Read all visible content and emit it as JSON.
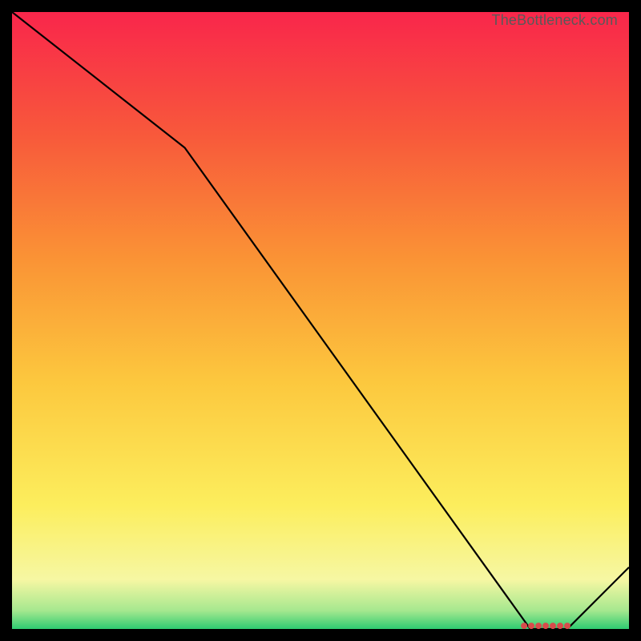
{
  "watermark": "TheBottleneck.com",
  "chart_data": {
    "type": "line",
    "x": [
      0,
      0.28,
      0.84,
      0.9,
      1.0
    ],
    "y": [
      1.0,
      0.78,
      0.0,
      0.0,
      0.1
    ],
    "title": "",
    "xlabel": "",
    "ylabel": "",
    "xlim": [
      0,
      1
    ],
    "ylim": [
      0,
      1
    ],
    "marker_region": {
      "x_start": 0.83,
      "x_end": 0.9,
      "y": 0.005
    }
  }
}
